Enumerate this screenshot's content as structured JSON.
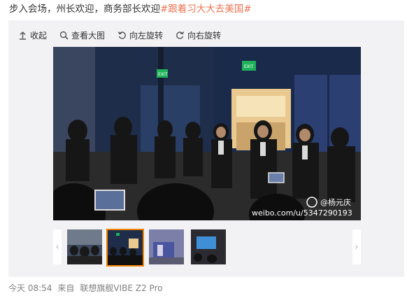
{
  "post": {
    "text_plain": "步入会场，州长欢迎，商务部长欢迎",
    "topic": "#跟着习大大去美国#"
  },
  "toolbar": {
    "collapse_label": "收起",
    "view_large_label": "查看大图",
    "rotate_left_label": "向左旋转",
    "rotate_right_label": "向右旋转"
  },
  "photo": {
    "watermark_user": "@杨元庆",
    "watermark_url": "weibo.com/u/5347290193",
    "exit_sign_left": "EXIT",
    "exit_sign_right": "EXIT"
  },
  "thumbnails": [
    {
      "active": false
    },
    {
      "active": true
    },
    {
      "active": false
    },
    {
      "active": false
    }
  ],
  "nav": {
    "prev_label": "‹",
    "next_label": "›"
  },
  "meta": {
    "time": "今天 08:54",
    "from_label": "来自",
    "device": "联想旗舰VIBE Z2 Pro"
  },
  "colors": {
    "topic": "#eb7350",
    "card_bg": "#f2f2f5",
    "active_thumb_border": "#f08300"
  }
}
